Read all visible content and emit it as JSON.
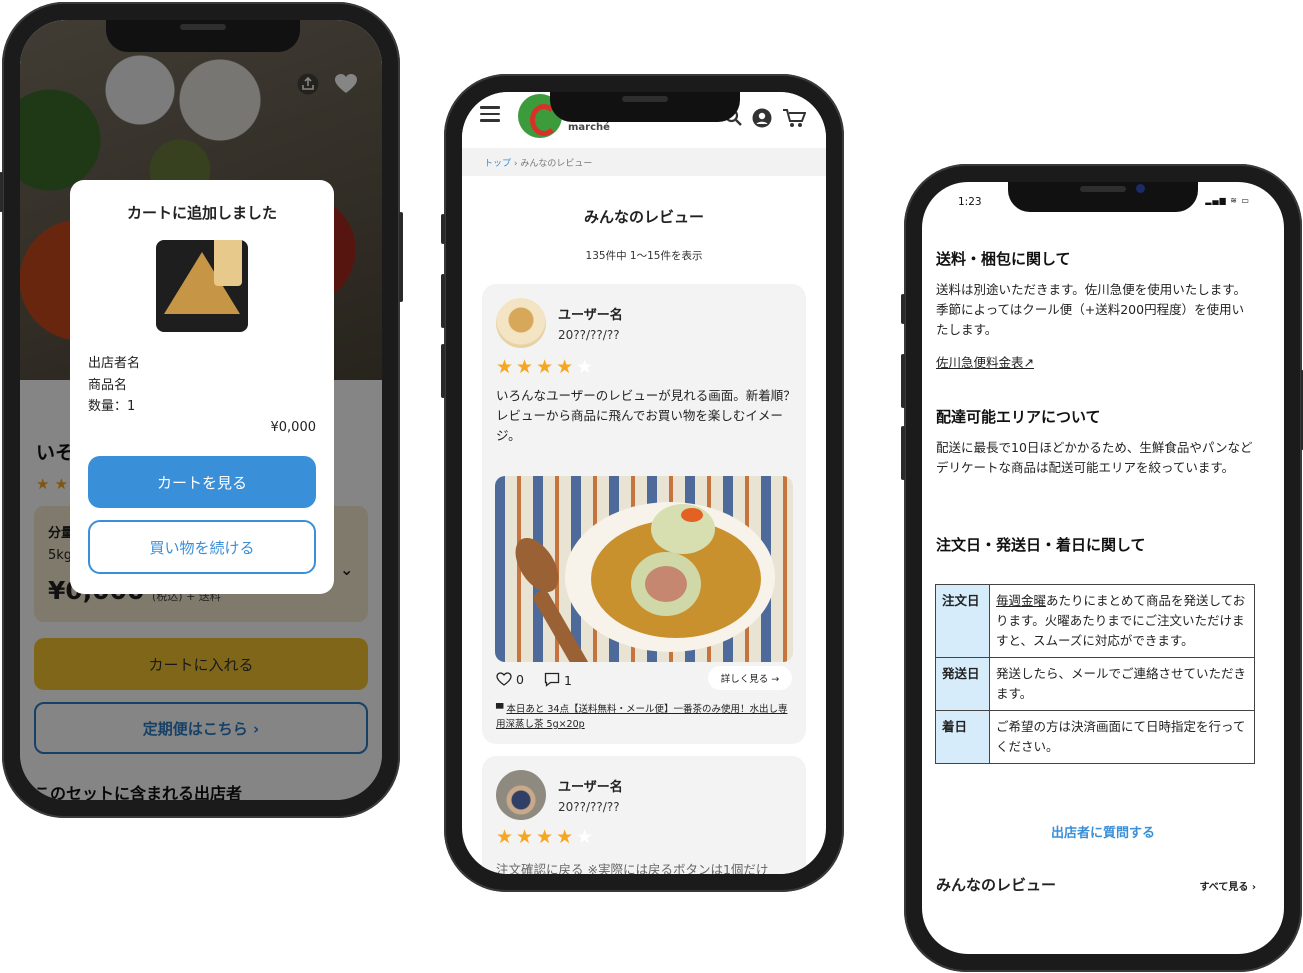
{
  "phone1": {
    "hero_icons": {
      "share": "share-icon",
      "favorite": "heart-icon"
    },
    "background": {
      "title": "いそ",
      "stars": "★ ★",
      "bunryo": "分量",
      "size": "5kg",
      "price": "¥0,000",
      "tax": "(税込) + 送料",
      "cart_button": "カートに入れる",
      "teiki_button": "定期便はこちら ›",
      "set_heading": "このセットに含まれる出店者"
    },
    "modal": {
      "title": "カートに追加しました",
      "seller": "出店者名",
      "product": "商品名",
      "quantity": "数量：1",
      "price": "¥0,000",
      "view_cart": "カートを見る",
      "continue": "買い物を続ける"
    }
  },
  "phone2": {
    "logo_text": "marché",
    "breadcrumb": {
      "home": "トップ",
      "separator": "›",
      "current": "みんなのレビュー"
    },
    "title": "みんなのレビュー",
    "count": "135件中 1〜15件を表示",
    "reviews": [
      {
        "user": "ユーザー名",
        "date": "20??/??/??",
        "rating": 4,
        "text": "いろんなユーザーのレビューが見れる画面。新着順？レビューから商品に飛んでお買い物を楽しむイメージ。",
        "likes": "0",
        "comments": "1",
        "more": "詳しく見る →",
        "product": "本日あと 34点【送料無料・メール便】一番茶のみ使用！水出し専用深蒸し茶 5g×20p"
      },
      {
        "user": "ユーザー名",
        "date": "20??/??/??",
        "rating": 4,
        "text": "注文確認に戻る ※実際には戻るボタンは1個だけ"
      }
    ]
  },
  "phone3": {
    "time": "1:23",
    "status_icons": "▂▄▆ ≋ ▭",
    "shipping": {
      "heading": "送料・梱包に関して",
      "body": "送料は別途いただきます。佐川急便を使用いたします。季節によってはクール便（+送料200円程度）を使用いたします。",
      "link": "佐川急便料金表↗"
    },
    "area": {
      "heading": "配達可能エリアについて",
      "body": "配送に最長で10日ほどかかるため、生鮮食品やパンなどデリケートな商品は配送可能エリアを絞っています。"
    },
    "dates": {
      "heading": "注文日・発送日・着日に関して",
      "rows": [
        {
          "label": "注文日",
          "highlight": "毎週金曜",
          "text": "あたりにまとめて商品を発送しております。火曜あたりまでにご注文いただけますと、スムーズに対応ができます。"
        },
        {
          "label": "発送日",
          "text": "発送したら、メールでご連絡させていただきます。"
        },
        {
          "label": "着日",
          "text": "ご希望の方は決済画面にて日時指定を行ってください。"
        }
      ]
    },
    "ask_seller": "出店者に質問する",
    "reviews_heading": "みんなのレビュー",
    "see_all": "すべて見る ›"
  }
}
